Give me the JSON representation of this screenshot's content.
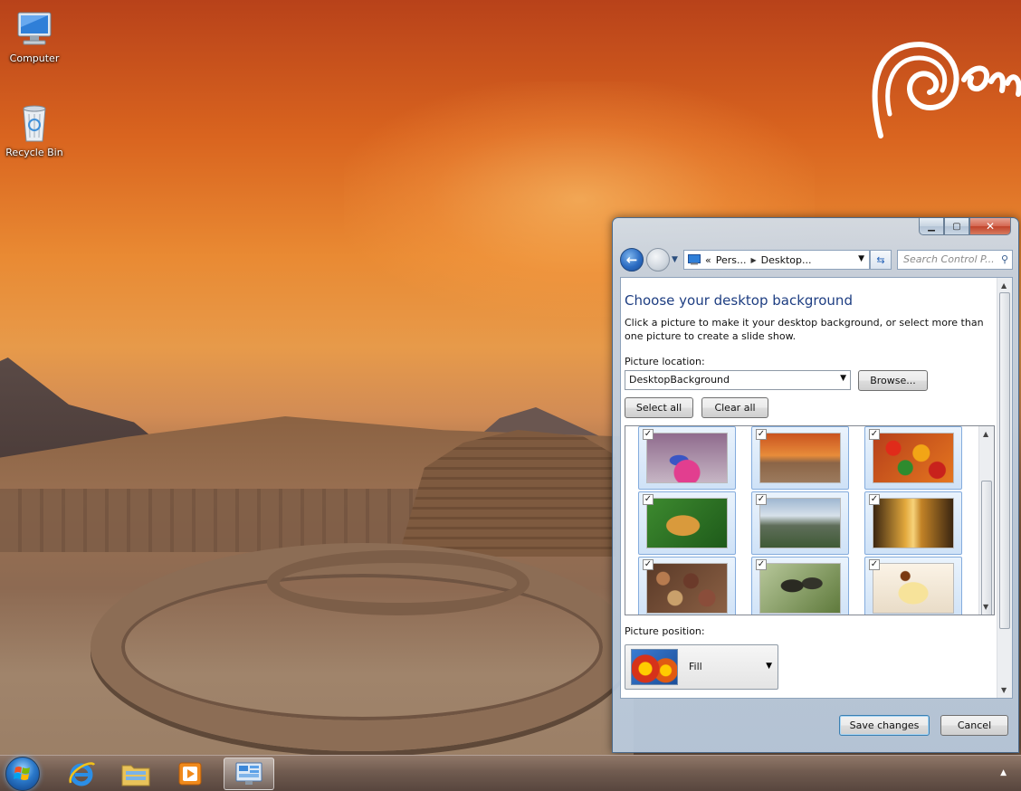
{
  "desktop": {
    "icons": [
      {
        "label": "Computer",
        "icon": "computer-icon"
      },
      {
        "label": "Recycle Bin",
        "icon": "recycle-bin-icon"
      }
    ]
  },
  "window": {
    "caption_buttons": {
      "minimize": "minimize-icon",
      "maximize": "maximize-icon",
      "close": "close-icon"
    },
    "nav": {
      "breadcrumb": [
        "«",
        "Pers...",
        "Desktop..."
      ],
      "search_placeholder": "Search Control P..."
    },
    "title": "Choose your desktop background",
    "description": "Click a picture to make it your desktop background, or select more than one picture to create a slide show.",
    "picture_location_label": "Picture location:",
    "picture_location_value": "DesktopBackground",
    "browse_label": "Browse...",
    "select_all_label": "Select all",
    "clear_all_label": "Clear all",
    "pictures": [
      {
        "name": "peru-dancer",
        "checked": true
      },
      {
        "name": "caral-ruins",
        "checked": true
      },
      {
        "name": "peppers",
        "checked": true
      },
      {
        "name": "jaguar",
        "checked": true
      },
      {
        "name": "machu-picchu",
        "checked": true
      },
      {
        "name": "cathedral",
        "checked": true
      },
      {
        "name": "potatoes",
        "checked": true
      },
      {
        "name": "monkeys",
        "checked": true
      },
      {
        "name": "dessert",
        "checked": true
      }
    ],
    "picture_position_label": "Picture position:",
    "picture_position_value": "Fill",
    "save_label": "Save changes",
    "cancel_label": "Cancel"
  },
  "taskbar": {
    "items": [
      "start-orb-icon",
      "internet-explorer-icon",
      "file-explorer-icon",
      "media-player-icon",
      "control-panel-icon"
    ],
    "active": "control-panel-icon"
  }
}
